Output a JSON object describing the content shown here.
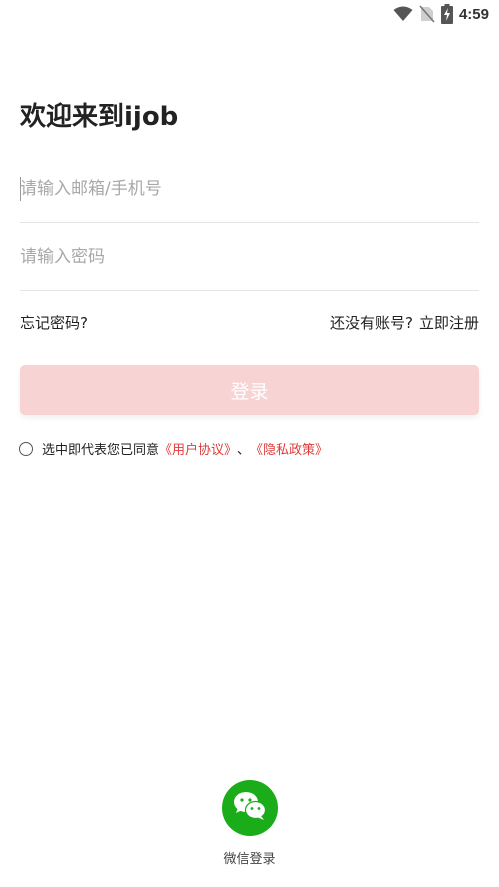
{
  "status_bar": {
    "time": "4:59",
    "icons": [
      "wifi-icon",
      "no-sim-icon",
      "battery-charging-icon"
    ]
  },
  "page": {
    "title": "欢迎来到ijob"
  },
  "form": {
    "email_placeholder": "请输入邮箱/手机号",
    "email_value": "",
    "password_placeholder": "请输入密码",
    "password_value": ""
  },
  "links": {
    "forgot_password": "忘记密码?",
    "no_account": "还没有账号?",
    "register_now": "立即注册"
  },
  "login_button": {
    "label": "登录",
    "color": "#f7d3d3"
  },
  "agreement": {
    "prefix": "选中即代表您已同意",
    "user_agreement": "《用户协议》",
    "separator": "、",
    "privacy_policy": "《隐私政策》",
    "checked": false,
    "link_color": "#e03b3b"
  },
  "wechat": {
    "label": "微信登录",
    "icon": "wechat-icon",
    "color": "#1aad19"
  }
}
